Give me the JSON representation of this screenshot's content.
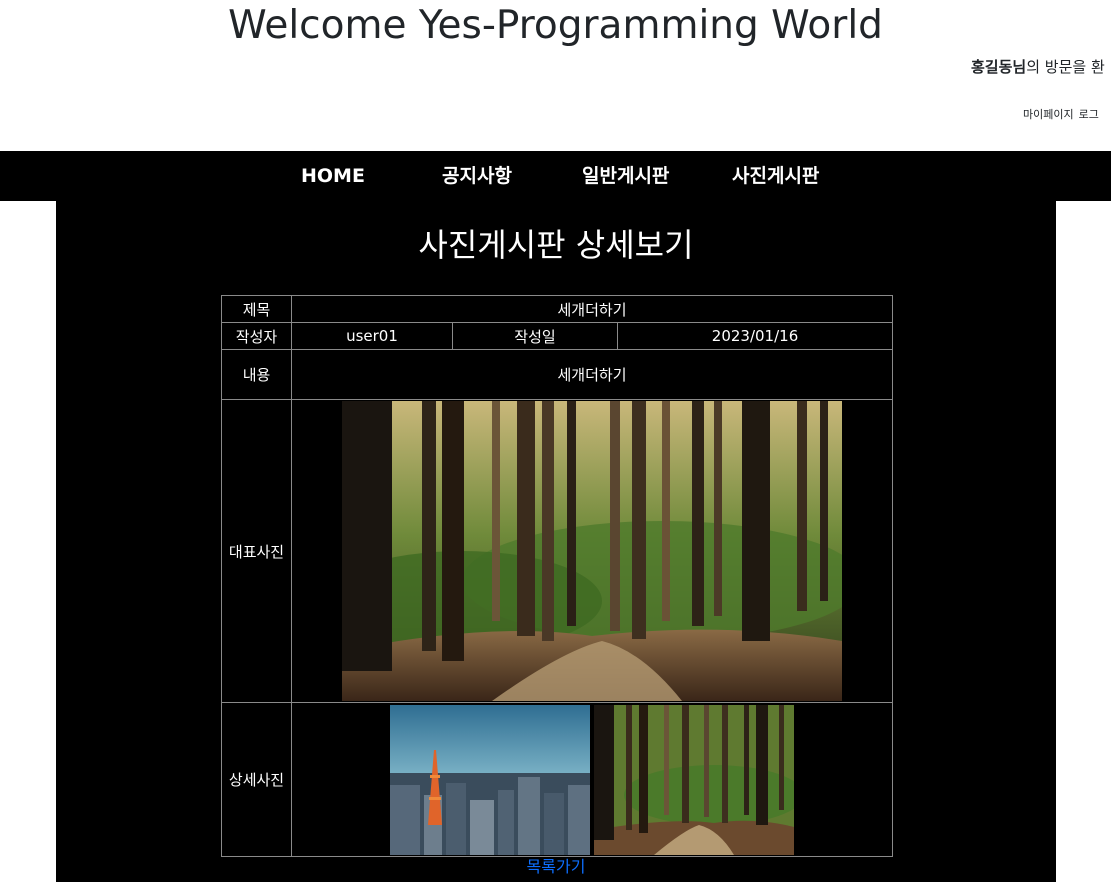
{
  "header": {
    "site_title": "Welcome Yes-Programming World",
    "user_name": "홍길동님",
    "welcome_suffix": "의 방문을 환",
    "links": [
      "마이페이지",
      "로그"
    ]
  },
  "nav": {
    "items": [
      "HOME",
      "공지사항",
      "일반게시판",
      "사진게시판"
    ]
  },
  "page": {
    "heading": "사진게시판 상세보기"
  },
  "detail": {
    "title_label": "제목",
    "title_value": "세개더하기",
    "writer_label": "작성자",
    "writer_value": "user01",
    "date_label": "작성일",
    "date_value": "2023/01/16",
    "content_label": "내용",
    "content_value": "세개더하기",
    "main_photo_label": "대표사진",
    "detail_photo_label": "상세사진",
    "detail_photos": [
      "tokyo-cityscape-photo",
      "forest-path-photo"
    ],
    "main_photo": "forest-path-photo"
  },
  "footer": {
    "list_link": "목록가기"
  },
  "colors": {
    "nav_bg": "#000000",
    "content_bg": "#000000",
    "link": "#0d6efd",
    "border": "#8a8a8a"
  }
}
